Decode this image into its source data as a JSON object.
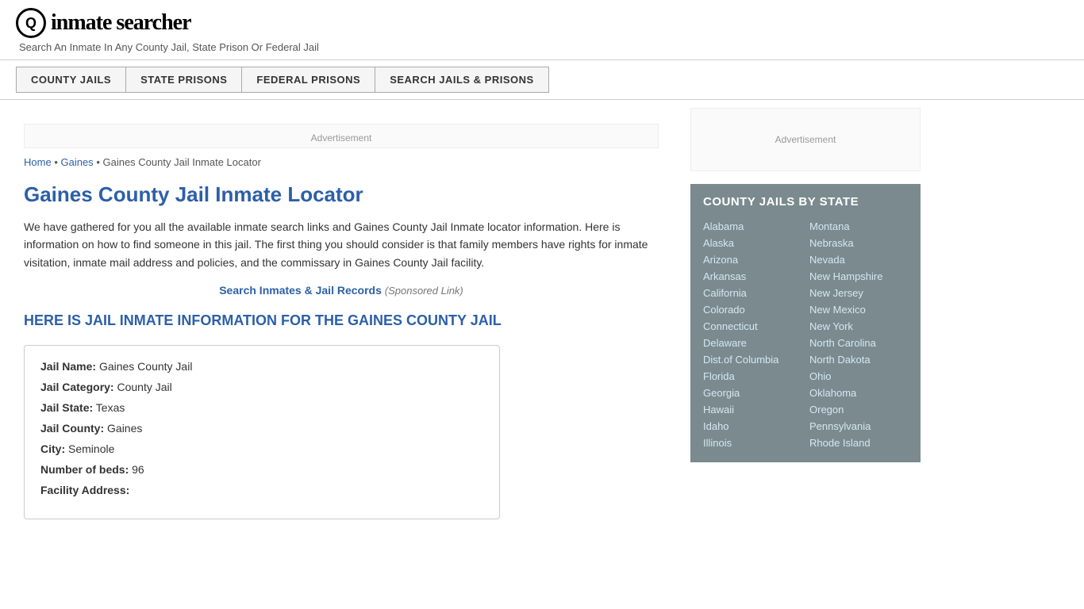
{
  "header": {
    "logo_icon": "Q",
    "logo_text": "inmate searcher",
    "tagline": "Search An Inmate In Any County Jail, State Prison Or Federal Jail"
  },
  "nav": {
    "items": [
      {
        "label": "COUNTY JAILS",
        "id": "county-jails"
      },
      {
        "label": "STATE PRISONS",
        "id": "state-prisons"
      },
      {
        "label": "FEDERAL PRISONS",
        "id": "federal-prisons"
      },
      {
        "label": "SEARCH JAILS & PRISONS",
        "id": "search-jails"
      }
    ]
  },
  "ad": {
    "text": "Advertisement"
  },
  "breadcrumb": {
    "home": "Home",
    "parent": "Gaines",
    "current": "Gaines County Jail Inmate Locator"
  },
  "page": {
    "title": "Gaines County Jail Inmate Locator",
    "description": "We have gathered for you all the available inmate search links and Gaines County Jail Inmate locator information. Here is information on how to find someone in this jail. The first thing you should consider is that family members have rights for inmate visitation, inmate mail address and policies, and the commissary in Gaines County Jail facility.",
    "sponsored_link_text": "Search Inmates & Jail Records",
    "sponsored_label": "(Sponsored Link)",
    "section_heading": "HERE IS JAIL INMATE INFORMATION FOR THE GAINES COUNTY JAIL"
  },
  "jail_info": {
    "name_label": "Jail Name:",
    "name_value": "Gaines County Jail",
    "category_label": "Jail Category:",
    "category_value": "County Jail",
    "state_label": "Jail State:",
    "state_value": "Texas",
    "county_label": "Jail County:",
    "county_value": "Gaines",
    "city_label": "City:",
    "city_value": "Seminole",
    "beds_label": "Number of beds:",
    "beds_value": "96",
    "address_label": "Facility Address:"
  },
  "sidebar": {
    "ad_text": "Advertisement",
    "state_box_title": "COUNTY JAILS BY STATE",
    "states_col1": [
      "Alabama",
      "Alaska",
      "Arizona",
      "Arkansas",
      "California",
      "Colorado",
      "Connecticut",
      "Delaware",
      "Dist.of Columbia",
      "Florida",
      "Georgia",
      "Hawaii",
      "Idaho",
      "Illinois"
    ],
    "states_col2": [
      "Montana",
      "Nebraska",
      "Nevada",
      "New Hampshire",
      "New Jersey",
      "New Mexico",
      "New York",
      "North Carolina",
      "North Dakota",
      "Ohio",
      "Oklahoma",
      "Oregon",
      "Pennsylvania",
      "Rhode Island"
    ]
  }
}
